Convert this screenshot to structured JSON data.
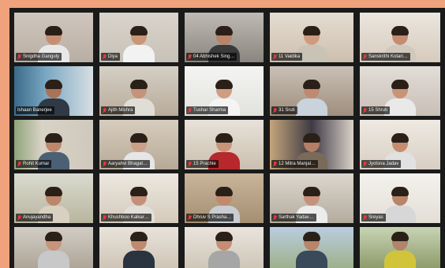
{
  "meeting": {
    "background_color": "#f0a27c",
    "window_color": "#1a1a1a",
    "mic_muted_color": "#e23b3b"
  },
  "participants": [
    {
      "name": "Snigdha Ganguly",
      "muted": true
    },
    {
      "name": "Diya",
      "muted": true
    },
    {
      "name": "04 Abhishek Sing…",
      "muted": true
    },
    {
      "name": "11 Vaidika",
      "muted": true
    },
    {
      "name": "Sanskrithi Kotari…",
      "muted": true
    },
    {
      "name": "Ishaan Banerjee",
      "muted": false
    },
    {
      "name": "Ajith Mishra",
      "muted": true
    },
    {
      "name": "Tushar Sharma",
      "muted": true
    },
    {
      "name": "31 Sruti",
      "muted": true
    },
    {
      "name": "15 Shruti",
      "muted": true
    },
    {
      "name": "Rohit Kumar",
      "muted": true
    },
    {
      "name": "Aaryahvi Bhagat…",
      "muted": true
    },
    {
      "name": "15 Prachie",
      "muted": true
    },
    {
      "name": "12 Mitra Manjal…",
      "muted": true
    },
    {
      "name": "Jyotsna Jadav",
      "muted": true
    },
    {
      "name": "Anujayandha",
      "muted": true
    },
    {
      "name": "Khushboo Kalkar…",
      "muted": true
    },
    {
      "name": "Dhruv S Prasha…",
      "muted": true
    },
    {
      "name": "Sarthak Yadav…",
      "muted": true
    },
    {
      "name": "Sreyas",
      "muted": true
    },
    {
      "name": "",
      "muted": false
    },
    {
      "name": "",
      "muted": false
    },
    {
      "name": "",
      "muted": false
    },
    {
      "name": "",
      "muted": false
    },
    {
      "name": "",
      "muted": false
    }
  ]
}
